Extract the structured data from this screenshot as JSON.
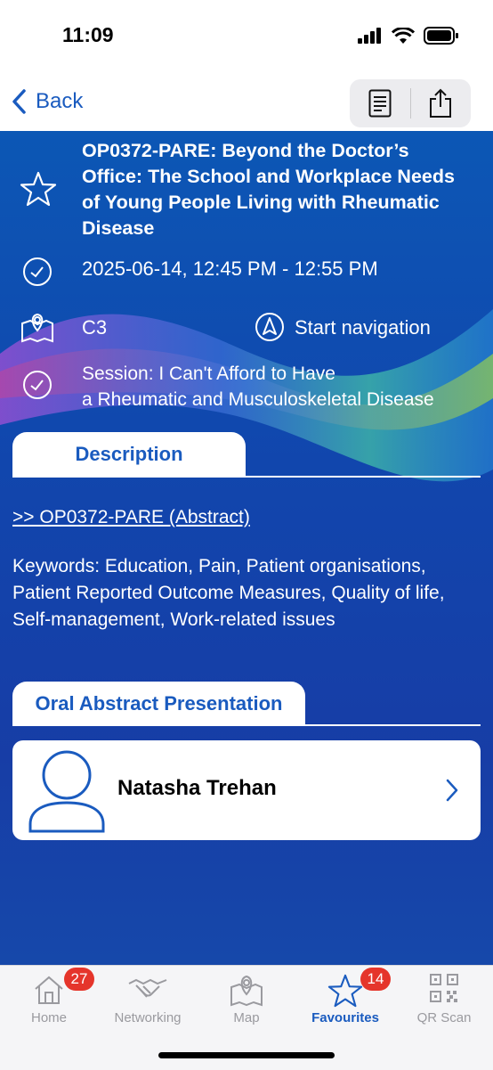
{
  "status": {
    "time": "11:09"
  },
  "nav": {
    "back_label": "Back"
  },
  "event": {
    "title": "OP0372-PARE: Beyond the Doctor’s Office: The School and Workplace Needs of Young People Living with Rheumatic Disease",
    "datetime": "2025-06-14, 12:45 PM - 12:55 PM",
    "room": "C3",
    "start_navigation": "Start navigation",
    "session_line1": "Session: I Can't Afford to Have",
    "session_line2": "a Rheumatic and Musculoskeletal Disease"
  },
  "description": {
    "tab_label": "Description",
    "abstract_link": ">> OP0372-PARE (Abstract)",
    "keywords": "Keywords: Education, Pain, Patient organisations, Patient Reported Outcome Measures, Quality of life, Self-management, Work-related issues"
  },
  "presentation": {
    "tab_label": "Oral Abstract Presentation",
    "presenter": "Natasha Trehan"
  },
  "tabbar": {
    "items": [
      {
        "label": "Home",
        "icon": "home-icon",
        "badge": "27"
      },
      {
        "label": "Networking",
        "icon": "handshake-icon"
      },
      {
        "label": "Map",
        "icon": "map-icon"
      },
      {
        "label": "Favourites",
        "icon": "star-icon",
        "badge": "14"
      },
      {
        "label": "QR Scan",
        "icon": "qr-code-icon"
      }
    ]
  },
  "colors": {
    "accent": "#1a5bbf",
    "badge": "#e5352b",
    "background_blue": "#1146ad"
  }
}
